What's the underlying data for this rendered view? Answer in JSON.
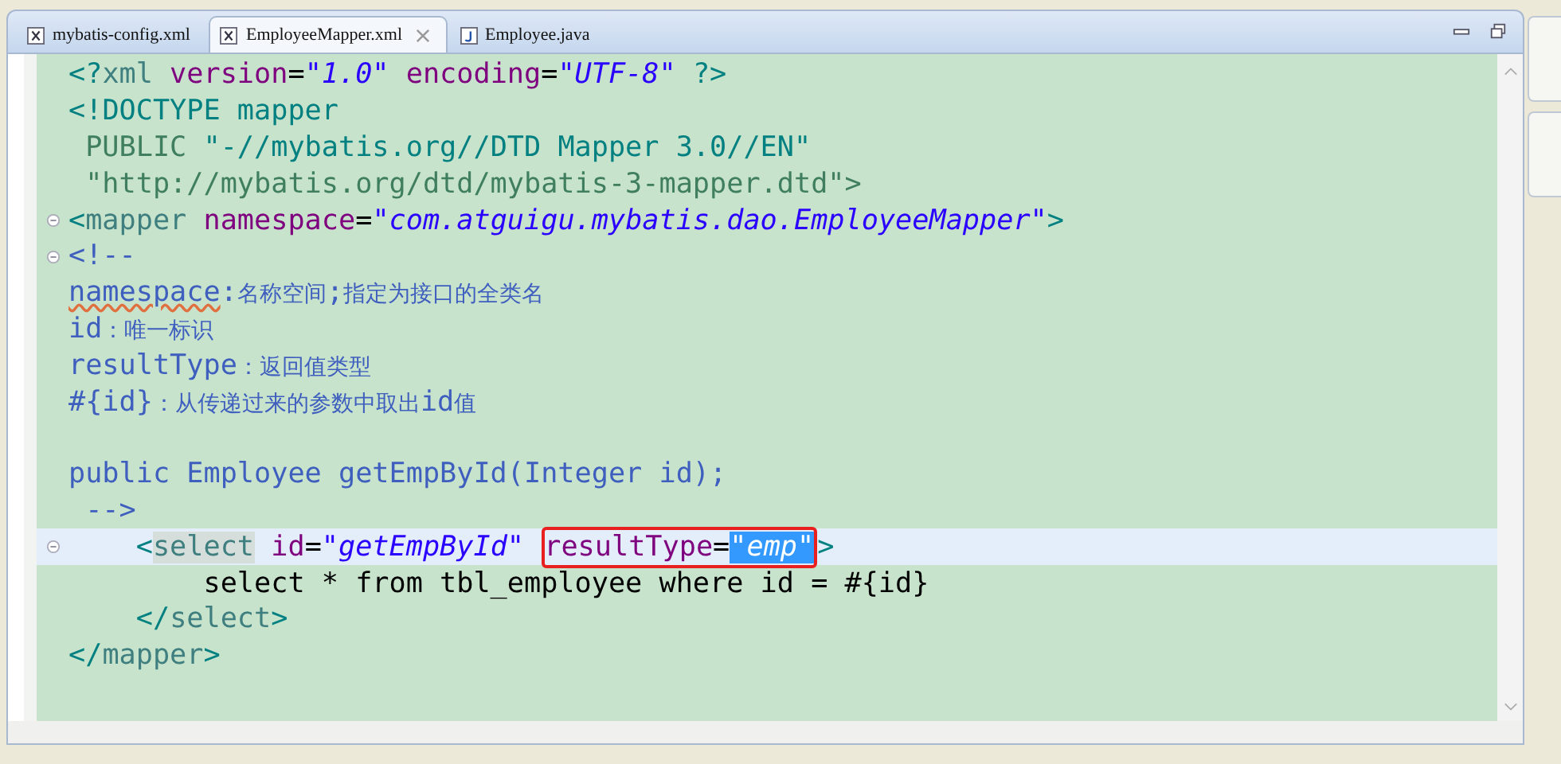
{
  "tabs": [
    {
      "label": "mybatis-config.xml",
      "kind": "xml",
      "selected": false
    },
    {
      "label": "EmployeeMapper.xml",
      "kind": "xml",
      "selected": true
    },
    {
      "label": "Employee.java",
      "kind": "java",
      "selected": false
    }
  ],
  "editor": {
    "lines": [
      {
        "fold": false,
        "current": false,
        "tokens": [
          {
            "kind": "punct",
            "text": "<?"
          },
          {
            "kind": "tag",
            "text": "xml"
          },
          {
            "kind": "attr",
            "text": " version"
          },
          {
            "kind": "text",
            "text": "="
          },
          {
            "kind": "value",
            "text": "\"1.0\""
          },
          {
            "kind": "attr",
            "text": " encoding"
          },
          {
            "kind": "text",
            "text": "="
          },
          {
            "kind": "value",
            "text": "\"UTF-8\""
          },
          {
            "kind": "punct",
            "text": " ?>"
          }
        ]
      },
      {
        "fold": false,
        "current": false,
        "tokens": [
          {
            "kind": "punct",
            "text": "<!"
          },
          {
            "kind": "doctype",
            "text": "DOCTYPE mapper"
          }
        ]
      },
      {
        "fold": false,
        "current": false,
        "tokens": [
          {
            "kind": "doctype-grey",
            "text": " PUBLIC"
          },
          {
            "kind": "doctype",
            "text": " \"-//mybatis.org//DTD Mapper 3.0//EN\""
          }
        ]
      },
      {
        "fold": false,
        "current": false,
        "tokens": [
          {
            "kind": "doctype-grey",
            "text": " \"http://mybatis.org/dtd/mybatis-3-mapper.dtd\">"
          }
        ]
      },
      {
        "fold": true,
        "current": false,
        "tokens": [
          {
            "kind": "punct",
            "text": "<"
          },
          {
            "kind": "tag",
            "text": "mapper"
          },
          {
            "kind": "attr",
            "text": " namespace"
          },
          {
            "kind": "text",
            "text": "="
          },
          {
            "kind": "value",
            "text": "\"com.atguigu.mybatis.dao.EmployeeMapper\""
          },
          {
            "kind": "punct",
            "text": ">"
          }
        ]
      },
      {
        "fold": true,
        "current": false,
        "tokens": [
          {
            "kind": "comment",
            "text": "<!--"
          }
        ]
      },
      {
        "fold": false,
        "current": false,
        "tokens": [
          {
            "kind": "comment-misspelled",
            "text": "namespace"
          },
          {
            "kind": "comment",
            "text": ":"
          },
          {
            "kind": "comment-cjk",
            "text": "名称空间"
          },
          {
            "kind": "comment",
            "text": ";"
          },
          {
            "kind": "comment-cjk",
            "text": "指定为接口的全类名"
          }
        ]
      },
      {
        "fold": false,
        "current": false,
        "tokens": [
          {
            "kind": "comment",
            "text": "id"
          },
          {
            "kind": "comment-cjk",
            "text": "：唯一标识"
          }
        ]
      },
      {
        "fold": false,
        "current": false,
        "tokens": [
          {
            "kind": "comment",
            "text": "resultType"
          },
          {
            "kind": "comment-cjk",
            "text": "：返回值类型"
          }
        ]
      },
      {
        "fold": false,
        "current": false,
        "tokens": [
          {
            "kind": "comment",
            "text": "#{id}"
          },
          {
            "kind": "comment-cjk",
            "text": "：从传递过来的参数中取出"
          },
          {
            "kind": "comment",
            "text": "id"
          },
          {
            "kind": "comment-cjk",
            "text": "值"
          }
        ]
      },
      {
        "fold": false,
        "current": false
      },
      {
        "fold": false,
        "current": false,
        "tokens": [
          {
            "kind": "comment",
            "text": "public Employee getEmpById(Integer id);"
          }
        ]
      },
      {
        "fold": false,
        "current": false,
        "tokens": [
          {
            "kind": "comment",
            "text": " -->"
          }
        ]
      },
      {
        "fold": true,
        "current": true,
        "tokens": [
          {
            "kind": "punct",
            "text": "    <"
          },
          {
            "kind": "tag-hl",
            "text": "select"
          },
          {
            "kind": "attr",
            "text": " id"
          },
          {
            "kind": "text",
            "text": "="
          },
          {
            "kind": "value",
            "text": "\"getEmpById\" "
          },
          {
            "kind": "box",
            "tokens": [
              {
                "kind": "attr",
                "text": "resultType"
              },
              {
                "kind": "text",
                "text": "="
              },
              {
                "kind": "value-selected",
                "text": "\"emp\""
              }
            ]
          },
          {
            "kind": "punct",
            "text": ">"
          }
        ]
      },
      {
        "fold": false,
        "current": false,
        "tokens": [
          {
            "kind": "text",
            "text": "        select * from tbl_employee where id = #{id}"
          }
        ]
      },
      {
        "fold": false,
        "current": false,
        "tokens": [
          {
            "kind": "punct",
            "text": "    </"
          },
          {
            "kind": "tag",
            "text": "select"
          },
          {
            "kind": "punct",
            "text": ">"
          }
        ]
      },
      {
        "fold": false,
        "current": false,
        "tokens": [
          {
            "kind": "punct",
            "text": "</"
          },
          {
            "kind": "tag",
            "text": "mapper"
          },
          {
            "kind": "punct",
            "text": ">"
          }
        ]
      }
    ]
  }
}
